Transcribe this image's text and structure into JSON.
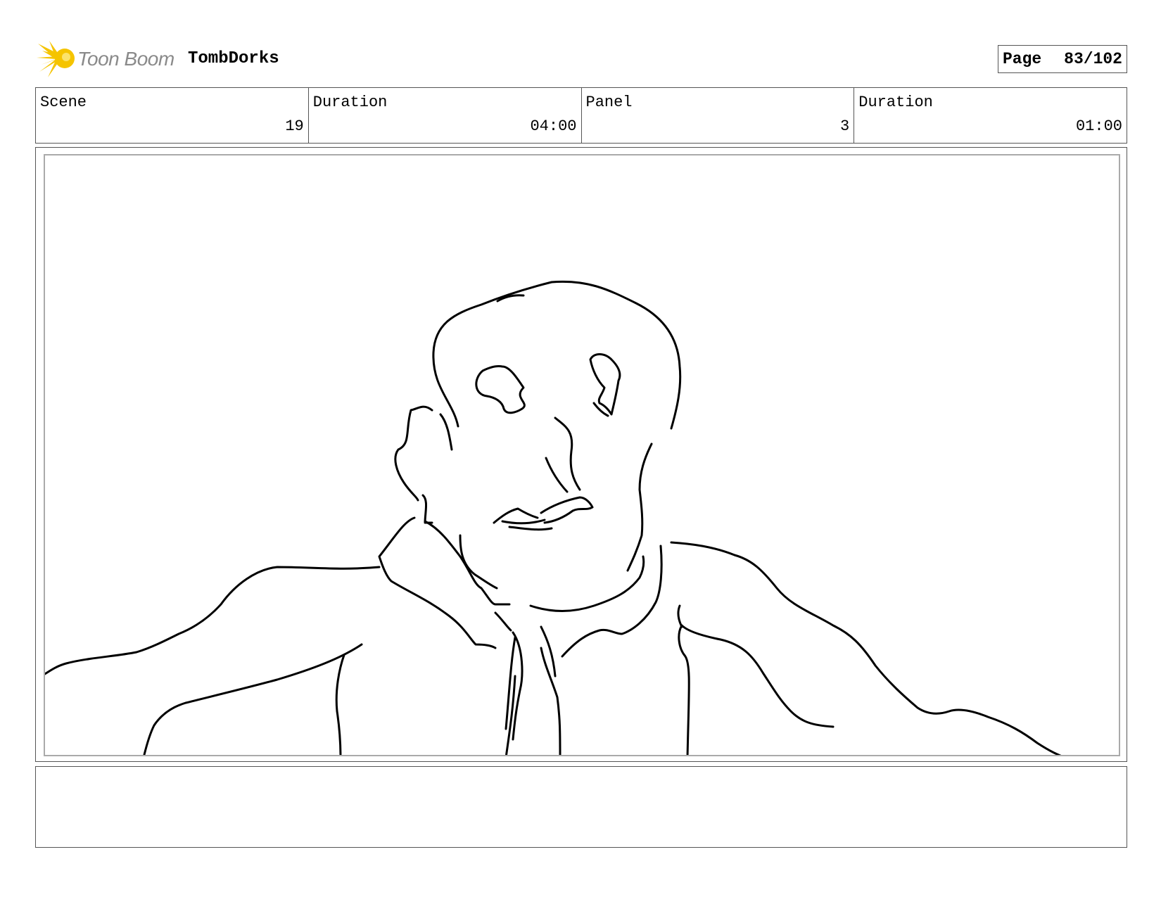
{
  "header": {
    "brand": "Toon Boom",
    "project_title": "TombDorks",
    "page_label": "Page",
    "page_number": "83/102"
  },
  "info": {
    "scene_label": "Scene",
    "scene_value": "19",
    "scene_duration_label": "Duration",
    "scene_duration_value": "04:00",
    "panel_label": "Panel",
    "panel_value": "3",
    "panel_duration_label": "Duration",
    "panel_duration_value": "01:00"
  },
  "colors": {
    "brand_yellow": "#f5c400",
    "brand_gray": "#8a8a8a"
  },
  "icons": {
    "logo": "toon-boom-burst-icon"
  }
}
